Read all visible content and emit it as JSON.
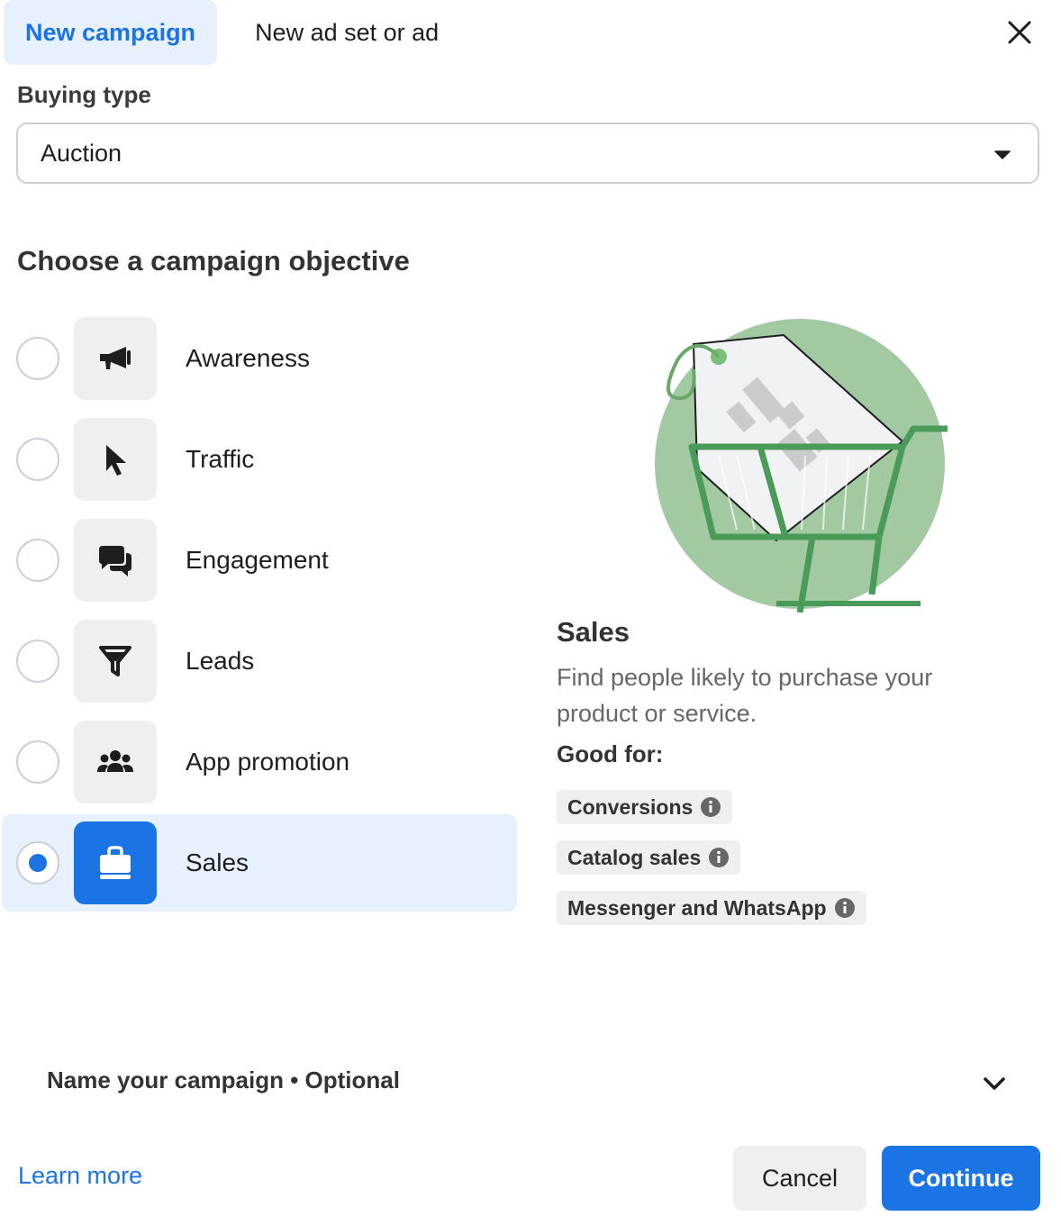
{
  "tabs": {
    "new_campaign": "New campaign",
    "new_adset_or_ad": "New ad set or ad"
  },
  "buying_type": {
    "label": "Buying type",
    "value": "Auction"
  },
  "objective_title": "Choose a campaign objective",
  "objectives": [
    {
      "label": "Awareness",
      "icon": "megaphone-icon",
      "selected": false
    },
    {
      "label": "Traffic",
      "icon": "cursor-icon",
      "selected": false
    },
    {
      "label": "Engagement",
      "icon": "chat-bubbles-icon",
      "selected": false
    },
    {
      "label": "Leads",
      "icon": "funnel-icon",
      "selected": false
    },
    {
      "label": "App promotion",
      "icon": "people-group-icon",
      "selected": false
    },
    {
      "label": "Sales",
      "icon": "shopping-bag-icon",
      "selected": true
    }
  ],
  "detail": {
    "title": "Sales",
    "description": "Find people likely to purchase your product or service.",
    "good_for_label": "Good for:",
    "good_for": [
      "Conversions",
      "Catalog sales",
      "Messenger and WhatsApp"
    ]
  },
  "name_campaign": "Name your campaign • Optional",
  "footer": {
    "learn_more": "Learn more",
    "cancel": "Cancel",
    "continue": "Continue"
  },
  "colors": {
    "accent": "#1b74e4",
    "selected_bg": "#e7f0fd",
    "illustration_green": "#a3c9a3"
  }
}
